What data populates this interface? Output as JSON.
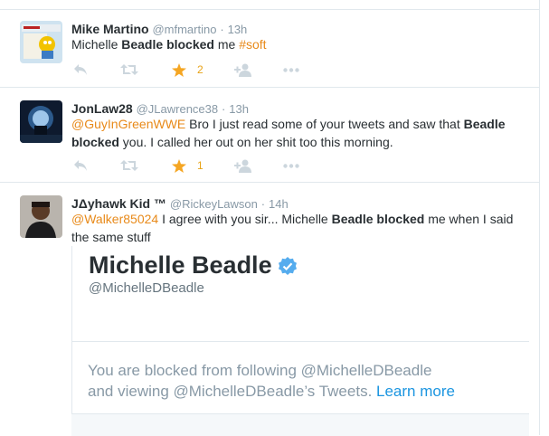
{
  "tweets": [
    {
      "name": "Mike Martino",
      "handle": "@mfmartino",
      "dot": "·",
      "time": "13h",
      "text_parts": [
        "Michelle ",
        "Beadle",
        " ",
        "blocked",
        " me ",
        "#soft"
      ],
      "favorites": "2"
    },
    {
      "name": "JonLaw28",
      "handle": "@JLawrence38",
      "dot": "·",
      "time": "13h",
      "text_line1": [
        "@GuyInGreenWWE",
        " Bro I just read some of your tweets and saw that ",
        "Beadle"
      ],
      "text_line2": [
        "blocked",
        " you. I called her out on her shit too this morning."
      ],
      "favorites": "1"
    },
    {
      "name": "JΔyhawk Kid ™",
      "handle": "@RickeyLawson",
      "dot": "·",
      "time": "14h",
      "text_line1": [
        "@Walker85024",
        " I agree with you sir... Michelle ",
        "Beadle",
        " ",
        "blocked",
        " me when I said"
      ],
      "text_line2": "the same stuff"
    }
  ],
  "card": {
    "name": "Michelle Beadle",
    "handle": "@MichelleDBeadle",
    "message_line1": "You are blocked from following @MichelleDBeadle",
    "message_line2": "and viewing @MichelleDBeadle’s Tweets. ",
    "learn_more": "Learn more"
  },
  "colors": {
    "link": "#e88a1a",
    "favorite": "#e8a317",
    "verified": "#55acee",
    "learn_more": "#1b95e0"
  },
  "icons": [
    "reply-icon",
    "retweet-icon",
    "favorite-icon",
    "follow-icon",
    "more-icon",
    "verified-badge-icon"
  ]
}
